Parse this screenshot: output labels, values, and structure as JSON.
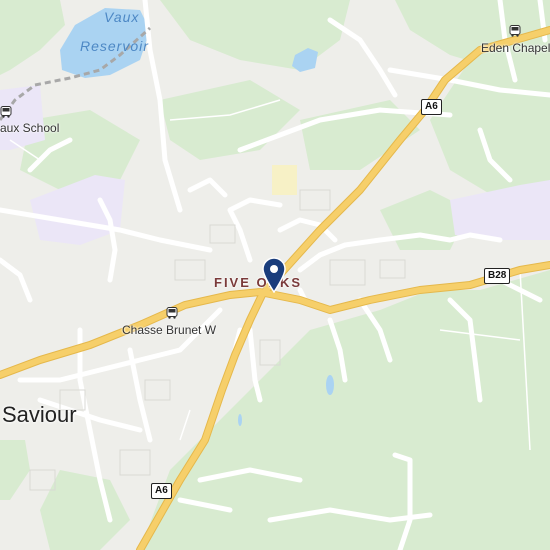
{
  "places": {
    "reservoir": "Vaux\nReservoir",
    "reservoir_line1": "Vaux",
    "reservoir_line2": "Reservoir",
    "village": "FIVE OAKS",
    "parish": "Saviour"
  },
  "stops": {
    "school": "aux School",
    "chasse": "Chasse Brunet W",
    "eden": "Eden Chapel"
  },
  "roads": {
    "a6_north": "A6",
    "a6_south": "A6",
    "b28": "B28"
  },
  "colors": {
    "land": "#eeeeea",
    "green": "#d8ebd0",
    "water": "#aad3f2",
    "major_road": "#f6cf6a",
    "minor_road": "#ffffff",
    "marker": "#1a3d7c",
    "school_area": "#ebe6f7"
  },
  "icons": {
    "marker": "location-pin-icon",
    "bus": "bus-stop-icon"
  }
}
